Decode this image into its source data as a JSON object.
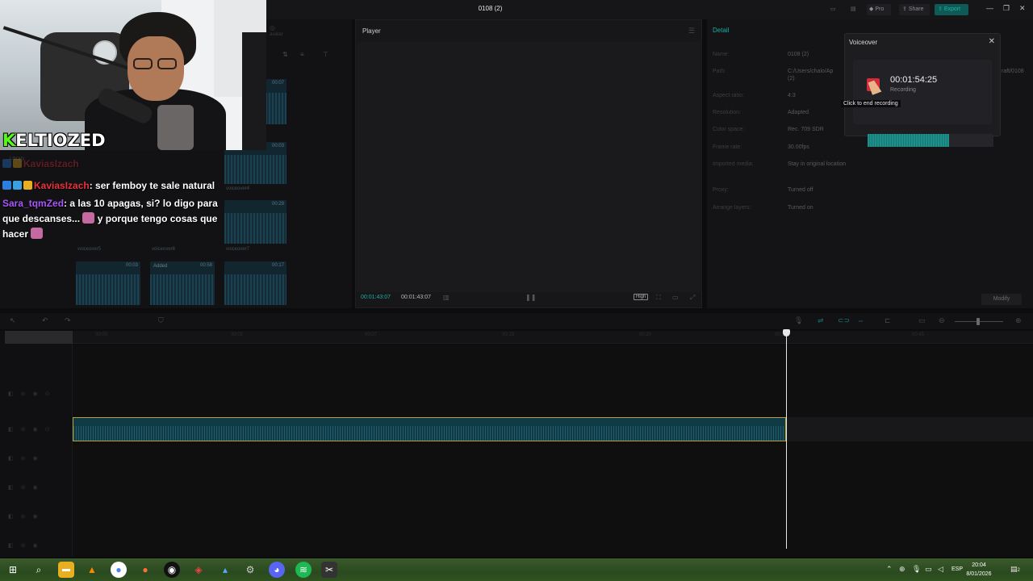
{
  "window": {
    "title": "0108 (2)",
    "pro_label": "Pro",
    "share_label": "Share",
    "export_label": "Export"
  },
  "overlay": {
    "streamer_logo": "ELTIOZED",
    "logo_k": "K",
    "chat": [
      {
        "user": "KaviasIzach",
        "user_color": "#e8323c",
        "message": ": ser femboy te sale natural"
      },
      {
        "user": "Sara_tqmZed",
        "user_color": "#a855f7",
        "message": ": a las 10 apagas, si? lo digo para"
      },
      {
        "user": "",
        "message": "que descanses..."
      },
      {
        "user": "",
        "message": "y porque tengo cosas que"
      },
      {
        "user": "",
        "message": "hacer"
      }
    ]
  },
  "media": {
    "library_label": "Library",
    "clips": [
      {
        "time": "00:07",
        "name": ""
      },
      {
        "time": "00:03",
        "name": "voiceover4"
      },
      {
        "time": "00:29",
        "name": "voiceover6"
      },
      {
        "time": "00:03",
        "name": "voiceover5"
      },
      {
        "time": "00:58",
        "name": "voiceover7"
      },
      {
        "time": "00:17",
        "name": ""
      }
    ],
    "added_label": "Added"
  },
  "player": {
    "title": "Player",
    "current_time": "00:01:43:07",
    "total_time": "00:01:43:07",
    "quality": "High"
  },
  "detail": {
    "title": "Detail",
    "fields": [
      {
        "label": "Name:",
        "value": "0108 (2)"
      },
      {
        "label": "Path:",
        "value": "C:/Users/chalo/Ap"
      },
      {
        "label": "Aspect ratio:",
        "value": "4:3"
      },
      {
        "label": "Resolution:",
        "value": "Adapted"
      },
      {
        "label": "Color space:",
        "value": "Rec. 709 SDR"
      },
      {
        "label": "Frame rate:",
        "value": "30.00fps"
      },
      {
        "label": "Imported media:",
        "value": "Stay in original location"
      },
      {
        "label": "Proxy:",
        "value": "Turned off"
      },
      {
        "label": "Arrange layers:",
        "value": "Turned on"
      }
    ],
    "path_suffix": "raft/0108",
    "path_line2": "(2)",
    "modify_label": "Modify"
  },
  "voiceover": {
    "title": "Voiceover",
    "time": "00:01:54:25",
    "status": "Recording",
    "tooltip": "Click to end recording",
    "input_level": 0.65,
    "rec_color": "#d42a39"
  },
  "timeline": {
    "ticks": [
      "00:00",
      "00:02",
      "00:07",
      "00:15",
      "00:20",
      "00:31",
      "00:45"
    ]
  },
  "taskbar": {
    "time": "20:04",
    "date": "8/01/2026",
    "lang": "ESP",
    "notifications": "2"
  }
}
